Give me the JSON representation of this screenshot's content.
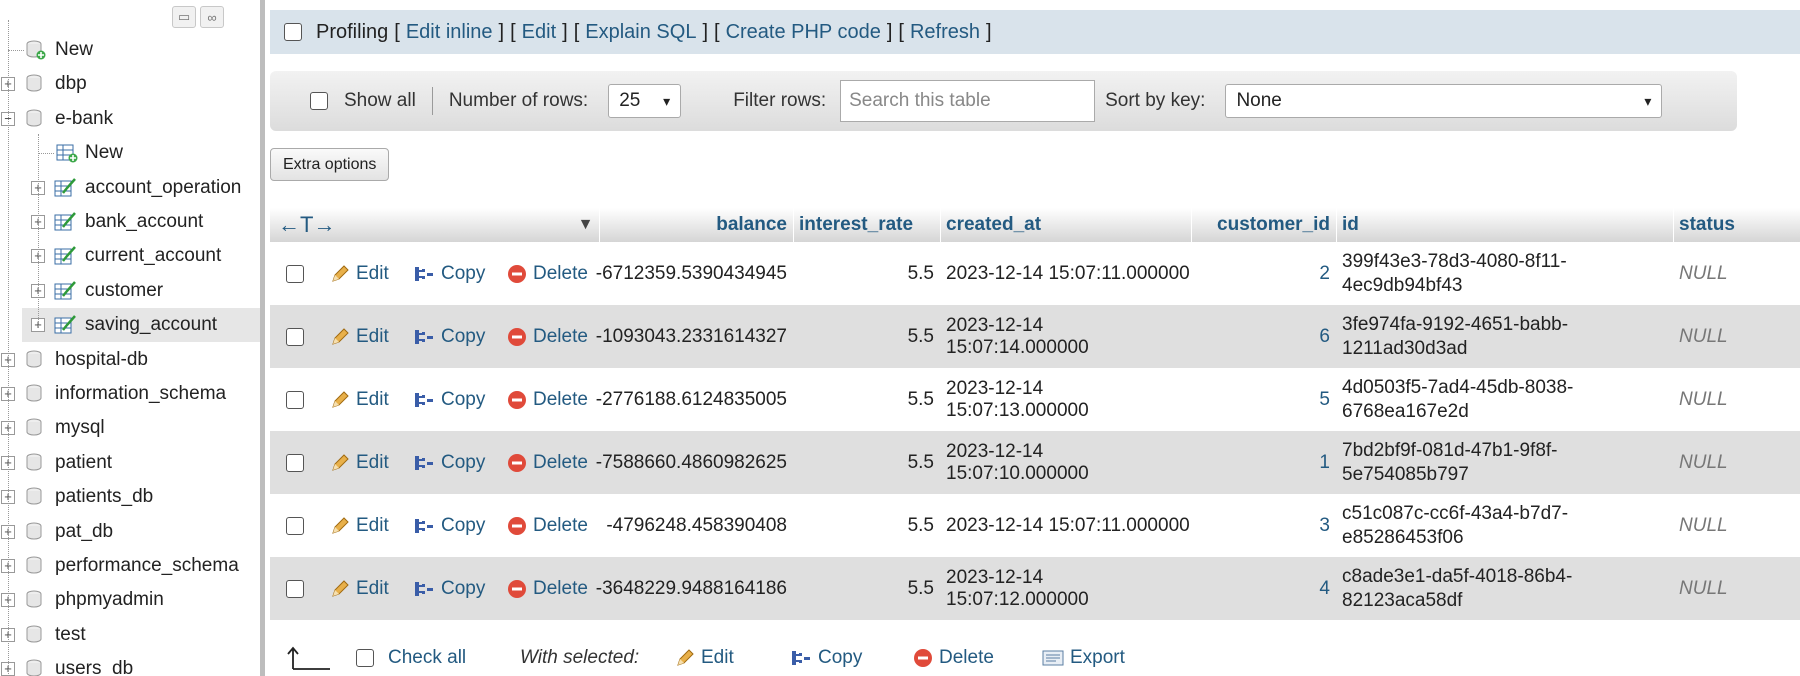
{
  "sidebar": {
    "items": [
      {
        "label": "New",
        "type": "new",
        "level": 0
      },
      {
        "label": "dbp",
        "type": "db",
        "level": 0
      },
      {
        "label": "e-bank",
        "type": "db",
        "level": 0,
        "expanded": true
      },
      {
        "label": "New",
        "type": "new-table",
        "level": 1
      },
      {
        "label": "account_operation",
        "type": "table",
        "level": 1
      },
      {
        "label": "bank_account",
        "type": "table",
        "level": 1
      },
      {
        "label": "current_account",
        "type": "table",
        "level": 1
      },
      {
        "label": "customer",
        "type": "table",
        "level": 1
      },
      {
        "label": "saving_account",
        "type": "table",
        "level": 1,
        "selected": true
      },
      {
        "label": "hospital-db",
        "type": "db",
        "level": 0
      },
      {
        "label": "information_schema",
        "type": "db",
        "level": 0
      },
      {
        "label": "mysql",
        "type": "db",
        "level": 0
      },
      {
        "label": "patient",
        "type": "db",
        "level": 0
      },
      {
        "label": "patients_db",
        "type": "db",
        "level": 0
      },
      {
        "label": "pat_db",
        "type": "db",
        "level": 0
      },
      {
        "label": "performance_schema",
        "type": "db",
        "level": 0
      },
      {
        "label": "phpmyadmin",
        "type": "db",
        "level": 0
      },
      {
        "label": "test",
        "type": "db",
        "level": 0
      },
      {
        "label": "users_db",
        "type": "db",
        "level": 0
      }
    ],
    "controls": {
      "collapse_icon": "collapse-icon",
      "link_icon": "link-icon"
    }
  },
  "profiling": {
    "label": "Profiling",
    "links": [
      "Edit inline",
      "Edit",
      "Explain SQL",
      "Create PHP code",
      "Refresh"
    ]
  },
  "nav": {
    "show_all": "Show all",
    "rows_label": "Number of rows:",
    "rows_value": "25",
    "filter_label": "Filter rows:",
    "filter_placeholder": "Search this table",
    "sort_label": "Sort by key:",
    "sort_value": "None"
  },
  "extra_options": "Extra options",
  "table": {
    "columns": [
      "balance",
      "interest_rate",
      "created_at",
      "customer_id",
      "id",
      "status"
    ],
    "row_actions": {
      "edit": "Edit",
      "copy": "Copy",
      "delete": "Delete"
    },
    "rows": [
      {
        "balance": "-6712359.5390434945",
        "interest_rate": "5.5",
        "created_at": "2023-12-14 15:07:11.000000",
        "customer_id": "2",
        "id_1": "399f43e3-78d3-4080-8f11-",
        "id_2": "4ec9db94bf43",
        "status": "NULL"
      },
      {
        "balance": "-1093043.2331614327",
        "interest_rate": "5.5",
        "created_at": "2023-12-14 15:07:14.000000",
        "customer_id": "6",
        "id_1": "3fe974fa-9192-4651-babb-",
        "id_2": "1211ad30d3ad",
        "status": "NULL"
      },
      {
        "balance": "-2776188.6124835005",
        "interest_rate": "5.5",
        "created_at": "2023-12-14 15:07:13.000000",
        "customer_id": "5",
        "id_1": "4d0503f5-7ad4-45db-8038-",
        "id_2": "6768ea167e2d",
        "status": "NULL"
      },
      {
        "balance": "-7588660.4860982625",
        "interest_rate": "5.5",
        "created_at": "2023-12-14 15:07:10.000000",
        "customer_id": "1",
        "id_1": "7bd2bf9f-081d-47b1-9f8f-",
        "id_2": "5e754085b797",
        "status": "NULL"
      },
      {
        "balance": "-4796248.458390408",
        "interest_rate": "5.5",
        "created_at": "2023-12-14 15:07:11.000000",
        "customer_id": "3",
        "id_1": "c51c087c-cc6f-43a4-b7d7-",
        "id_2": "e85286453f06",
        "status": "NULL"
      },
      {
        "balance": "-3648229.9488164186",
        "interest_rate": "5.5",
        "created_at": "2023-12-14 15:07:12.000000",
        "customer_id": "4",
        "id_1": "c8ade3e1-da5f-4018-86b4-",
        "id_2": "82123aca58df",
        "status": "NULL"
      }
    ]
  },
  "footer": {
    "check_all": "Check all",
    "with_selected": "With selected:",
    "edit": "Edit",
    "copy": "Copy",
    "delete": "Delete",
    "export": "Export"
  },
  "colors": {
    "link": "#235a81",
    "header_bar": "#d9e3eb",
    "row_alt": "#dfdfdf"
  }
}
